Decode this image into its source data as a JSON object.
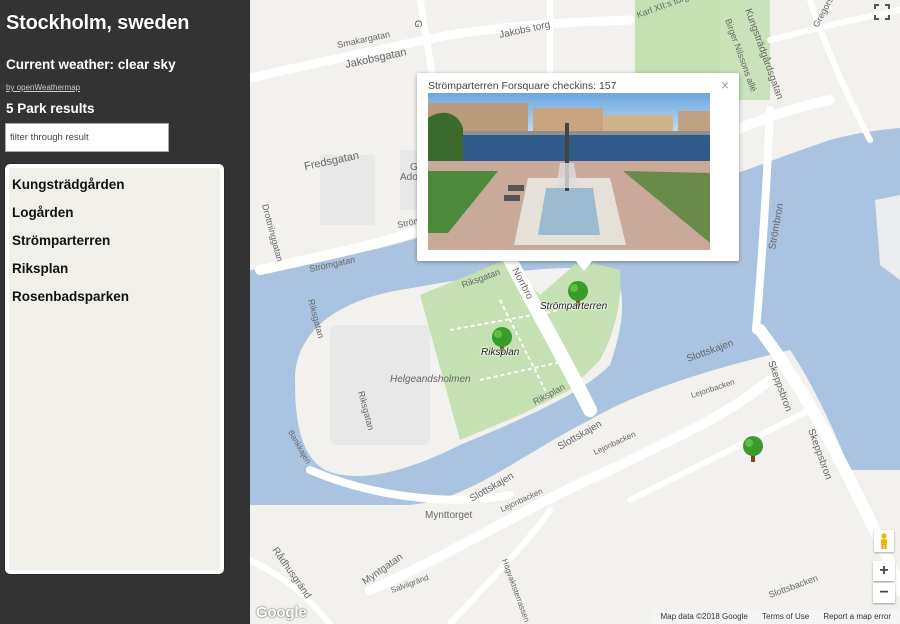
{
  "sidebar": {
    "city": "Stockholm, sweden",
    "weather": "Current weather: clear sky",
    "weather_credit": "by openWeathermap",
    "results_count": "5 Park results",
    "filter_placeholder": "filter through result",
    "parks": [
      "Kungsträdgården",
      "Logården",
      "Strömparterren",
      "Riksplan",
      "Rosenbadsparken"
    ]
  },
  "map": {
    "info_window": {
      "title": "Strömparterren Forsquare checkins: 157",
      "close": "×"
    },
    "markers": [
      {
        "name": "Strömparterren",
        "label": "Strömparterren"
      },
      {
        "name": "Riksplan",
        "label": "Riksplan"
      },
      {
        "name": "Logården",
        "label": ""
      }
    ],
    "streets": {
      "kungstradgardsgatan": "Kungsträdgårdsgatan",
      "jakobsgatan": "Jakobsgatan",
      "jakobs_torg": "Jakobs torg",
      "karl_xii": "Karl XII:s torg",
      "birger": "Birger Nilssons allé",
      "fredsgatan": "Fredsgatan",
      "drottninggatan": "Drottninggatan",
      "stromgatan": "Strömgatan",
      "stromgatan2": "Strömgatan",
      "strombron": "Strömbron",
      "norrbro": "Norrbro",
      "riksgatan": "Riksgatan",
      "riksplan": "Riksplan",
      "helgeandsholmen": "Helgeandsholmen",
      "riksgatan2": "Riksgatan",
      "bankkajen": "Bankkajen",
      "slottskajen": "Slottskajen",
      "slottskajen2": "Slottskajen",
      "slottskajen3": "Slottskajen",
      "lejonbacken": "Lejonbacken",
      "lejonbacken2": "Lejonbacken",
      "lejonbacken3": "Lejonbacken",
      "skeppsbron": "Skeppsbron",
      "skeppsbron2": "Skeppsbron",
      "mynttorget": "Mynttorget",
      "myntgatan": "Myntgatan",
      "radhusgrand": "Rådhusgränd",
      "salviigrand": "Salviigränd",
      "hogvaktsterrassen": "Högvaktsterrassen",
      "slottsbacken": "Slottsbacken",
      "gregorsgrand": "Gregorsgrand",
      "smakargatan": "Smakargatan",
      "adolf": "Ado",
      "g": "G"
    },
    "google": "Google",
    "attribution": {
      "data": "Map data ©2018 Google",
      "terms": "Terms of Use",
      "report": "Report a map error"
    },
    "zoom_in": "+",
    "zoom_out": "−"
  },
  "colors": {
    "sidebar_bg": "#333333",
    "list_bg": "#f0efe9",
    "water": "#aac3e0",
    "park": "#c5e0b2",
    "land": "#f2f1ee",
    "road": "#ffffff",
    "marker_tree": "#3a9a2c"
  }
}
